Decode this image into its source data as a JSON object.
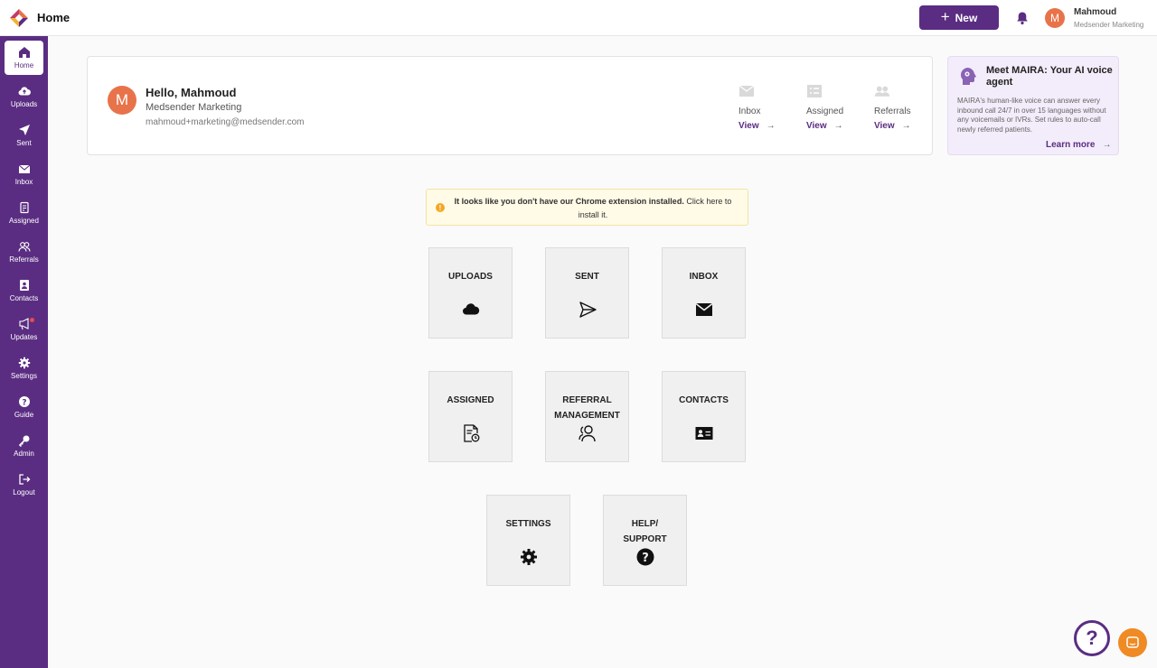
{
  "header": {
    "title": "Home",
    "new_label": "New",
    "user": {
      "initial": "M",
      "name": "Mahmoud",
      "org": "Medsender Marketing"
    }
  },
  "sidebar": {
    "items": [
      {
        "label": "Home",
        "icon": "home-icon"
      },
      {
        "label": "Uploads",
        "icon": "cloud-upload-icon"
      },
      {
        "label": "Sent",
        "icon": "send-icon"
      },
      {
        "label": "Inbox",
        "icon": "mail-icon"
      },
      {
        "label": "Assigned",
        "icon": "assigned-icon"
      },
      {
        "label": "Referrals",
        "icon": "referrals-icon"
      },
      {
        "label": "Contacts",
        "icon": "contacts-icon"
      },
      {
        "label": "Updates",
        "icon": "megaphone-icon"
      },
      {
        "label": "Settings",
        "icon": "gear-icon"
      },
      {
        "label": "Guide",
        "icon": "question-icon"
      },
      {
        "label": "Admin",
        "icon": "key-icon"
      },
      {
        "label": "Logout",
        "icon": "logout-icon"
      }
    ]
  },
  "hello": {
    "initial": "M",
    "greeting": "Hello, Mahmoud",
    "org": "Medsender Marketing",
    "email": "mahmoud+marketing@medsender.com",
    "quick_links": [
      {
        "label": "Inbox",
        "action": "View"
      },
      {
        "label": "Assigned",
        "action": "View"
      },
      {
        "label": "Referrals",
        "action": "View"
      }
    ]
  },
  "maira": {
    "title": "Meet MAIRA: Your AI voice agent",
    "body": "MAIRA's human-like voice can answer every inbound call 24/7 in over 15 languages without any voicemails or IVRs. Set rules to auto-call newly referred patients.",
    "link": "Learn more"
  },
  "notice": {
    "bold": "It looks like you don't have our Chrome extension installed.",
    "rest": " Click here to install it."
  },
  "tiles": {
    "uploads": "UPLOADS",
    "sent": "SENT",
    "inbox": "INBOX",
    "assigned": "ASSIGNED",
    "referral": "REFERRAL\nMANAGEMENT",
    "contacts": "CONTACTS",
    "settings": "SETTINGS",
    "help": "HELP/\nSUPPORT"
  },
  "colors": {
    "brand": "#5a2d82",
    "avatar": "#e8734a",
    "chat": "#f08a24"
  }
}
